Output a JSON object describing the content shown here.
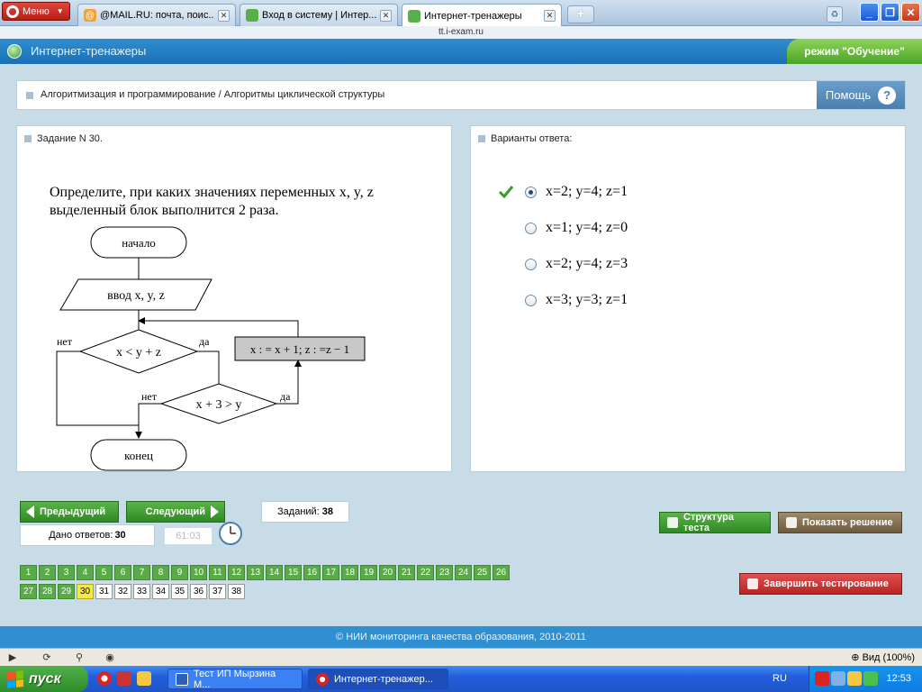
{
  "browser": {
    "menu_label": "Меню",
    "tabs": [
      {
        "title": "@MAIL.RU: почта, поис...",
        "close": "✕"
      },
      {
        "title": "Вход в систему | Интер...",
        "close": "✕"
      },
      {
        "title": "Интернет-тренажеры",
        "close": "✕"
      }
    ],
    "new_tab": "+",
    "address": "tt.i-exam.ru"
  },
  "app": {
    "title": "Интернет-тренажеры",
    "mode": "режим \"Обучение\""
  },
  "breadcrumb": "Алгоритмизация и программирование / Алгоритмы циклической структуры",
  "help": {
    "label": "Помощь",
    "icon": "?"
  },
  "task": {
    "header": "Задание N 30.",
    "question": "Определите, при каких значениях переменных x, y, z выделенный блок выполнится 2 раза.",
    "flowchart": {
      "start": "начало",
      "input": "ввод  x, y, z",
      "cond1": "x < y + z",
      "cond1_no": "нет",
      "cond1_yes": "да",
      "action": "x : = x + 1; z : =z − 1",
      "cond2": "x + 3 > y",
      "cond2_no": "нет",
      "cond2_yes": "да",
      "end": "конец"
    }
  },
  "answers": {
    "header": "Варианты ответа:",
    "options": [
      {
        "text": "x=2; y=4; z=1",
        "selected": true,
        "correct": true
      },
      {
        "text": "x=1; y=4; z=0",
        "selected": false,
        "correct": false
      },
      {
        "text": "x=2; y=4; z=3",
        "selected": false,
        "correct": false
      },
      {
        "text": "x=3; y=3; z=1",
        "selected": false,
        "correct": false
      }
    ]
  },
  "controls": {
    "prev": "Предыдущий",
    "next": "Следующий",
    "tasks_label": "Заданий:",
    "tasks_count": "38",
    "answered_label": "Дано ответов:",
    "answered_count": "30",
    "timer": "61:03",
    "structure": "Структура теста",
    "solution": "Показать решение",
    "finish": "Завершить тестирование"
  },
  "task_numbers": {
    "current": 30,
    "answered_through": 29,
    "total": 38
  },
  "footer": "© НИИ мониторинга качества образования, 2010-2011",
  "status": {
    "zoom": "Вид (100%)"
  },
  "taskbar": {
    "start": "пуск",
    "items": [
      "Тест ИП Мырзина М...",
      "Интернет-тренажер..."
    ],
    "lang": "RU",
    "time": "12:53"
  },
  "colors": {
    "header_blue": "#2f8fd0",
    "done_green": "#5aab48",
    "current_yellow": "#f5e94a",
    "finish_red": "#c83030"
  }
}
